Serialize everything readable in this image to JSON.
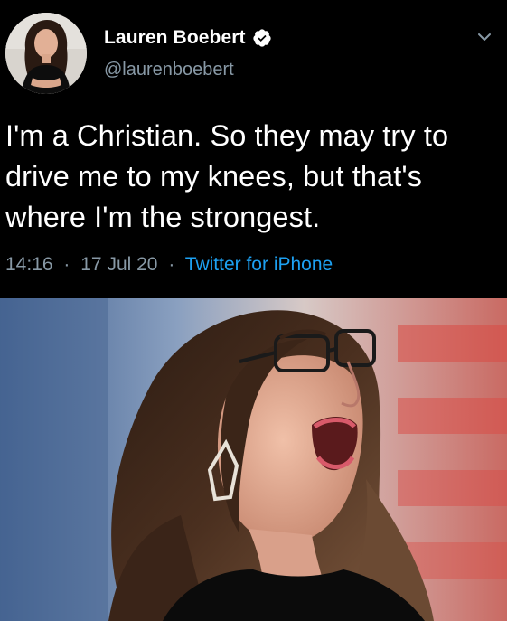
{
  "tweet": {
    "author": {
      "display_name": "Lauren Boebert",
      "handle": "@laurenboebert",
      "verified": true
    },
    "text": "I'm a Christian. So they may try to drive me to my knees, but that's where I'm the strongest.",
    "time": "14:16",
    "separator": "·",
    "date": "17 Jul 20",
    "source": "Twitter for iPhone"
  },
  "colors": {
    "background": "#000000",
    "text": "#ffffff",
    "secondary_text": "#8899a6",
    "link": "#1da1f2",
    "verified_badge": "#ffffff"
  },
  "icons": {
    "verified": "verified-badge-icon",
    "menu": "chevron-down-icon"
  }
}
